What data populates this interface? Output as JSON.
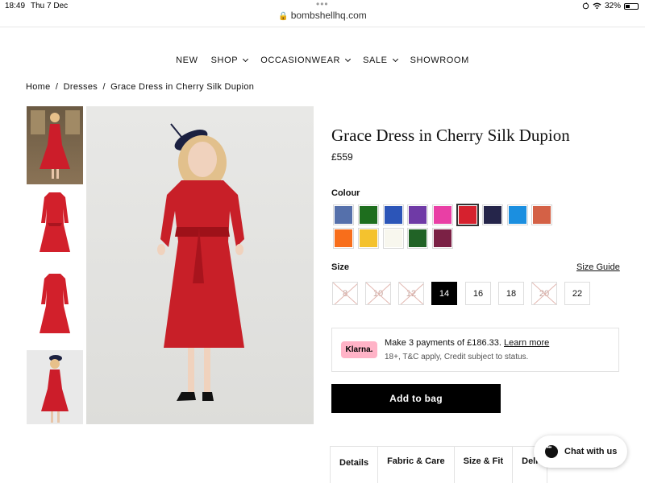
{
  "status_bar": {
    "time": "18:49",
    "date": "Thu 7 Dec",
    "battery": "32%"
  },
  "browser": {
    "url": "bombshellhq.com"
  },
  "nav": {
    "items": [
      {
        "label": "NEW",
        "dropdown": false
      },
      {
        "label": "SHOP",
        "dropdown": true
      },
      {
        "label": "OCCASIONWEAR",
        "dropdown": true
      },
      {
        "label": "SALE",
        "dropdown": true
      },
      {
        "label": "SHOWROOM",
        "dropdown": false
      }
    ]
  },
  "breadcrumb": {
    "items": [
      "Home",
      "/",
      "Dresses",
      "/",
      "Grace Dress in Cherry Silk Dupion"
    ]
  },
  "product": {
    "title": "Grace Dress in Cherry Silk Dupion",
    "price": "£559",
    "colour_label": "Colour",
    "colours": [
      {
        "hex": "#5570ab",
        "selected": false
      },
      {
        "hex": "#1e6e1e",
        "selected": false
      },
      {
        "hex": "#2c55b8",
        "selected": false
      },
      {
        "hex": "#6f3aa6",
        "selected": false
      },
      {
        "hex": "#e93fa5",
        "selected": false
      },
      {
        "hex": "#d6212e",
        "selected": true
      },
      {
        "hex": "#25254a",
        "selected": false
      },
      {
        "hex": "#1b8fe0",
        "selected": false
      },
      {
        "hex": "#d46146",
        "selected": false
      },
      {
        "hex": "#f86e1b",
        "selected": false
      },
      {
        "hex": "#f4c22e",
        "selected": false
      },
      {
        "hex": "#f8f7ee",
        "selected": false
      },
      {
        "hex": "#216326",
        "selected": false
      },
      {
        "hex": "#7b2145",
        "selected": false
      }
    ],
    "size_label": "Size",
    "size_guide": "Size Guide",
    "sizes": [
      {
        "label": "8",
        "available": false,
        "selected": false
      },
      {
        "label": "10",
        "available": false,
        "selected": false
      },
      {
        "label": "12",
        "available": false,
        "selected": false
      },
      {
        "label": "14",
        "available": true,
        "selected": true
      },
      {
        "label": "16",
        "available": true,
        "selected": false
      },
      {
        "label": "18",
        "available": true,
        "selected": false
      },
      {
        "label": "20",
        "available": false,
        "selected": false
      },
      {
        "label": "22",
        "available": true,
        "selected": false
      }
    ],
    "klarna": {
      "logo": "Klarna.",
      "text": "Make 3 payments of £186.33.",
      "link": "Learn more",
      "subtext": "18+, T&C apply, Credit subject to status."
    },
    "add_to_bag": "Add to bag",
    "tabs": [
      "Details",
      "Fabric & Care",
      "Size & Fit",
      "Deli"
    ]
  },
  "chat": {
    "label": "Chat with us"
  }
}
